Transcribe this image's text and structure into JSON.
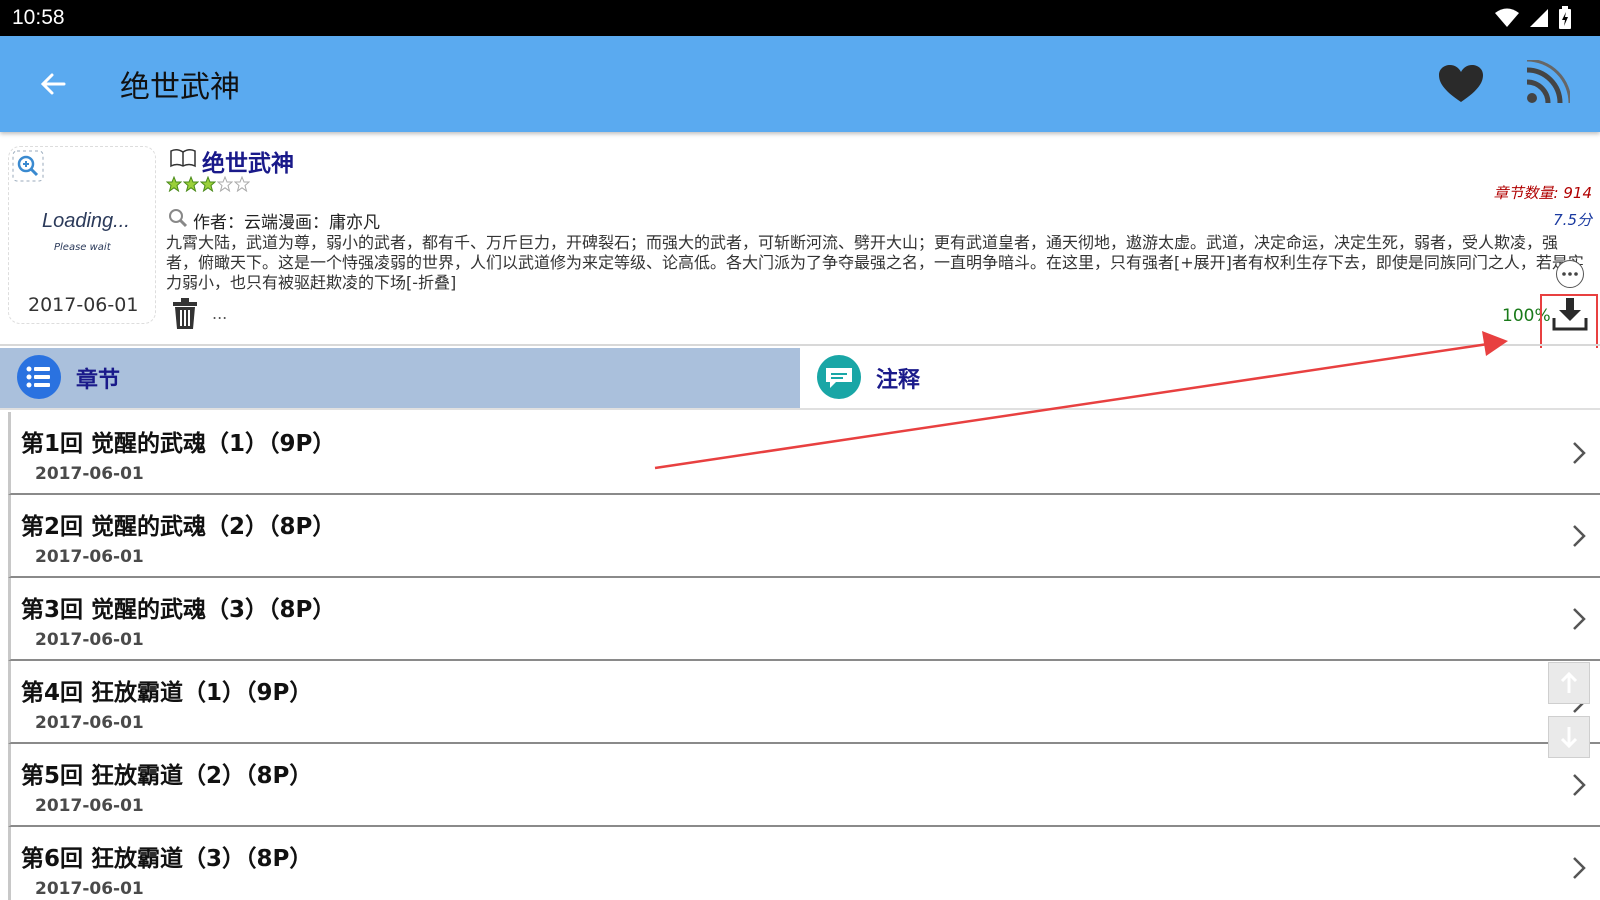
{
  "status_bar": {
    "time": "10:58"
  },
  "app_bar": {
    "title": "绝世武神"
  },
  "book": {
    "cover_loading": "Loading...",
    "cover_please_wait": "Please wait",
    "cover_date": "2017-06-01",
    "title": "绝世武神",
    "rating_stars": 3,
    "rating_max": 5,
    "chapter_count": "章节数量: 914",
    "score": "7.5分",
    "author": "作者：云端漫画：庸亦凡",
    "description": "九霄大陆，武道为尊，弱小的武者，都有千、万斤巨力，开碑裂石；而强大的武者，可斩断河流、劈开大山；更有武道皇者，通天彻地，遨游太虚。武道，决定命运，决定生死，弱者，受人欺凌，强者，俯瞰天下。这是一个恃强凌弱的世界，人们以武道修为来定等级、论高低。各大门派为了争夺最强之名，一直明争暗斗。在这里，只有强者[+展开]者有权利生存下去，即使是同族同门之人，若是实力弱小，也只有被驱赶欺凌的下场[-折叠]",
    "ellipsis": "...",
    "download_percent": "100%"
  },
  "tabs": [
    {
      "label": "章节"
    },
    {
      "label": "注释"
    }
  ],
  "chapters": [
    {
      "title": "第1回 觉醒的武魂（1）（9P）",
      "date": "2017-06-01"
    },
    {
      "title": "第2回 觉醒的武魂（2）（8P）",
      "date": "2017-06-01"
    },
    {
      "title": "第3回 觉醒的武魂（3）（8P）",
      "date": "2017-06-01"
    },
    {
      "title": "第4回 狂放霸道（1）（9P）",
      "date": "2017-06-01"
    },
    {
      "title": "第5回 狂放霸道（2）（8P）",
      "date": "2017-06-01"
    },
    {
      "title": "第6回 狂放霸道（3）（8P）",
      "date": "2017-06-01"
    }
  ],
  "colors": {
    "app_bar": "#5aaaf0",
    "active_tab": "#aac0dc",
    "title_blue": "#1a1a8a",
    "chapter_count_red": "#b00000",
    "score_blue": "#1a3aa0",
    "percent_green": "#1a7a1a",
    "annotation_red": "#e84040"
  },
  "icons": {
    "back": "arrow-left-icon",
    "favorite": "heart-icon",
    "rss": "rss-icon",
    "zoom": "zoom-in-icon",
    "book": "open-book-icon",
    "search": "search-icon",
    "delete": "trash-icon",
    "more": "more-icon",
    "download": "download-icon",
    "chapters_tab": "list-icon",
    "notes_tab": "chat-bubble-icon",
    "chevron": "chevron-right-icon",
    "scroll_up": "arrow-up-icon",
    "scroll_down": "arrow-down-icon"
  }
}
